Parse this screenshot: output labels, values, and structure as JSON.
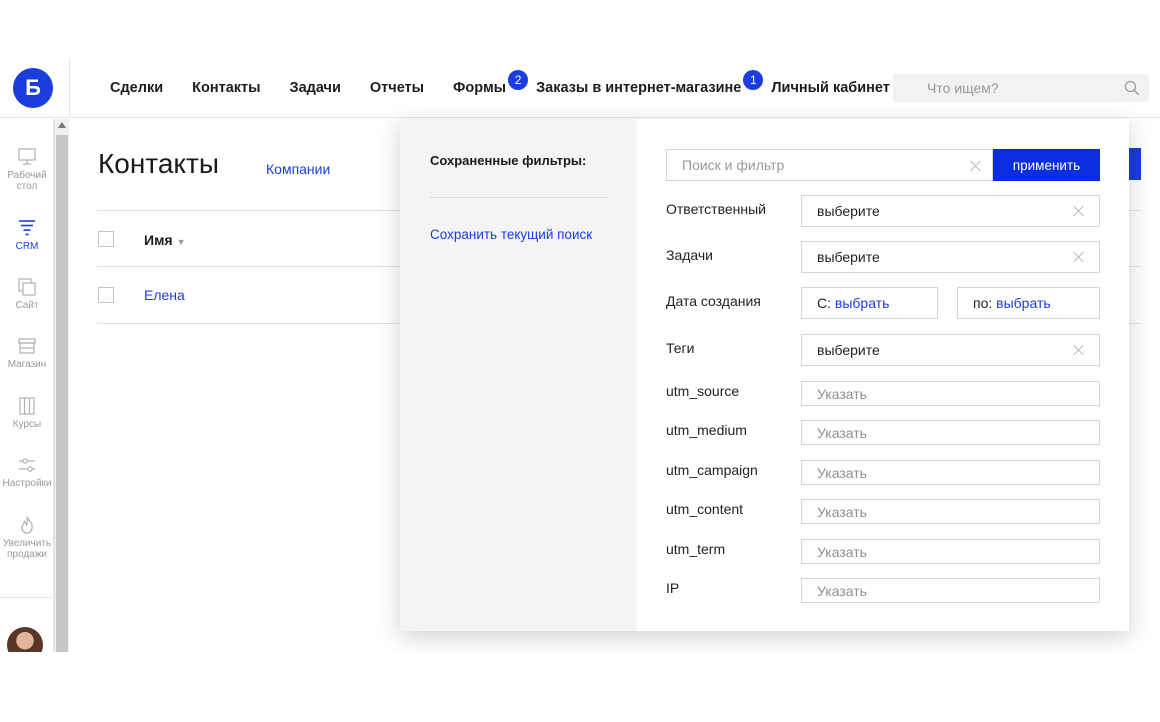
{
  "logo": {
    "letter": "Б"
  },
  "nav": {
    "items": [
      {
        "label": "Сделки"
      },
      {
        "label": "Контакты"
      },
      {
        "label": "Задачи"
      },
      {
        "label": "Отчеты"
      },
      {
        "label": "Формы",
        "badge": "2"
      },
      {
        "label": "Заказы в интернет-магазине",
        "badge": "1"
      },
      {
        "label": "Личный кабинет"
      }
    ]
  },
  "search": {
    "placeholder": "Что ищем?"
  },
  "sidebar": {
    "items": [
      {
        "label": "Рабочий стол",
        "icon": "monitor-icon"
      },
      {
        "label": "CRM",
        "icon": "funnel-icon",
        "active": true
      },
      {
        "label": "Сайт",
        "icon": "pages-icon"
      },
      {
        "label": "Магазин",
        "icon": "store-icon"
      },
      {
        "label": "Курсы",
        "icon": "books-icon"
      },
      {
        "label": "Настройки",
        "icon": "sliders-icon"
      },
      {
        "label": "Увеличить продажи",
        "icon": "flame-icon"
      }
    ]
  },
  "main": {
    "title": "Контакты",
    "tab_companies": "Компании",
    "column_name": "Имя",
    "rows": [
      {
        "name": "Елена"
      }
    ]
  },
  "filter": {
    "saved_title": "Сохраненные фильтры:",
    "save_current": "Сохранить текущий поиск",
    "search_placeholder": "Поиск и фильтр",
    "apply_label": "применить",
    "responsible": {
      "label": "Ответственный",
      "value": "выберите"
    },
    "tasks": {
      "label": "Задачи",
      "value": "выберите"
    },
    "created": {
      "label": "Дата создания",
      "from_prefix": "С:",
      "from_link": "выбрать",
      "to_prefix": "по:",
      "to_link": "выбрать"
    },
    "tags": {
      "label": "Теги",
      "value": "выберите"
    },
    "text_fields": [
      {
        "label": "utm_source",
        "placeholder": "Указать"
      },
      {
        "label": "utm_medium",
        "placeholder": "Указать"
      },
      {
        "label": "utm_campaign",
        "placeholder": "Указать"
      },
      {
        "label": "utm_content",
        "placeholder": "Указать"
      },
      {
        "label": "utm_term",
        "placeholder": "Указать"
      },
      {
        "label": "IP",
        "placeholder": "Указать"
      }
    ]
  },
  "colors": {
    "accent": "#1a3ddb",
    "apply": "#0a2de0",
    "panel_left_bg": "#f4f4f4"
  }
}
